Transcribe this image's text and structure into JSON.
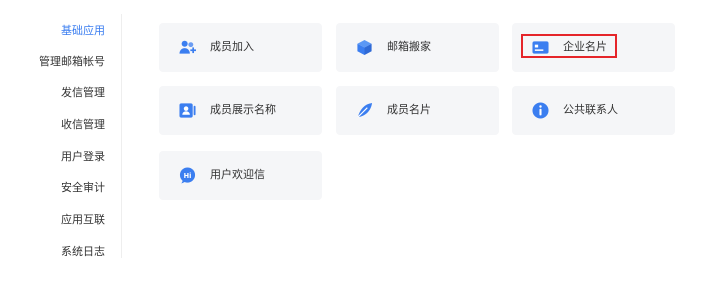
{
  "sidebar": {
    "items": [
      {
        "label": "基础应用",
        "active": true
      },
      {
        "label": "管理邮箱帐号",
        "active": false
      },
      {
        "label": "发信管理",
        "active": false
      },
      {
        "label": "收信管理",
        "active": false
      },
      {
        "label": "用户登录",
        "active": false
      },
      {
        "label": "安全审计",
        "active": false
      },
      {
        "label": "应用互联",
        "active": false
      },
      {
        "label": "系统日志",
        "active": false
      }
    ]
  },
  "apps": [
    {
      "label": "成员加入",
      "icon": "member-join-icon"
    },
    {
      "label": "邮箱搬家",
      "icon": "mailbox-move-icon"
    },
    {
      "label": "企业名片",
      "icon": "enterprise-card-icon",
      "highlighted": true
    },
    {
      "label": "成员展示名称",
      "icon": "member-display-name-icon"
    },
    {
      "label": "成员名片",
      "icon": "member-card-icon"
    },
    {
      "label": "公共联系人",
      "icon": "info-icon"
    },
    {
      "label": "用户欢迎信",
      "icon": "hi-chat-icon"
    }
  ],
  "colors": {
    "accent": "#3b7ef0",
    "card_bg": "#f5f6f8",
    "highlight": "#e5252a"
  }
}
